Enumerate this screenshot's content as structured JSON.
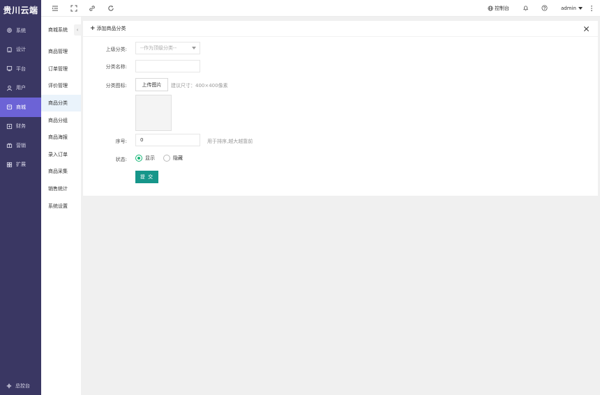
{
  "brand": "贵川云端",
  "sidebar": {
    "items": [
      {
        "label": "系统",
        "icon": "gear-icon"
      },
      {
        "label": "设计",
        "icon": "design-icon"
      },
      {
        "label": "平台",
        "icon": "monitor-icon"
      },
      {
        "label": "用户",
        "icon": "user-icon"
      },
      {
        "label": "商城",
        "icon": "shop-icon",
        "active": true
      },
      {
        "label": "财务",
        "icon": "finance-icon"
      },
      {
        "label": "营销",
        "icon": "gift-icon"
      },
      {
        "label": "扩展",
        "icon": "apps-icon"
      }
    ],
    "bottom_label": "总控台"
  },
  "subnav": {
    "title": "商城系统",
    "collapse_glyph": "‹",
    "items": [
      {
        "label": "商品管理"
      },
      {
        "label": "订单管理"
      },
      {
        "label": "评价管理"
      },
      {
        "label": "商品分类",
        "active": true
      },
      {
        "label": "商品分组"
      },
      {
        "label": "商品海报"
      },
      {
        "label": "录入订单"
      },
      {
        "label": "商品采集"
      },
      {
        "label": "销售统计"
      },
      {
        "label": "系统设置"
      }
    ]
  },
  "topbar": {
    "console_label": "控制台",
    "user_label": "admin"
  },
  "card": {
    "title": "添加商品分类",
    "parent": {
      "label": "上级分类:",
      "placeholder": "--作为顶级分类--"
    },
    "name": {
      "label": "分类名称:",
      "value": ""
    },
    "icon": {
      "label": "分类图标:",
      "upload_label": "上传图片",
      "hint": "建议尺寸：400×400像素"
    },
    "order": {
      "label": "序号:",
      "value": "0",
      "hint": "用于排序,越大越靠前"
    },
    "status": {
      "label": "状态:",
      "options": [
        "显示",
        "隐藏"
      ],
      "selected": "显示"
    },
    "submit_label": "提 交"
  },
  "colors": {
    "sidebar_bg": "#3a3763",
    "sidebar_active": "#6c63d6",
    "submit": "#16968a",
    "radio_on": "#16b777"
  }
}
